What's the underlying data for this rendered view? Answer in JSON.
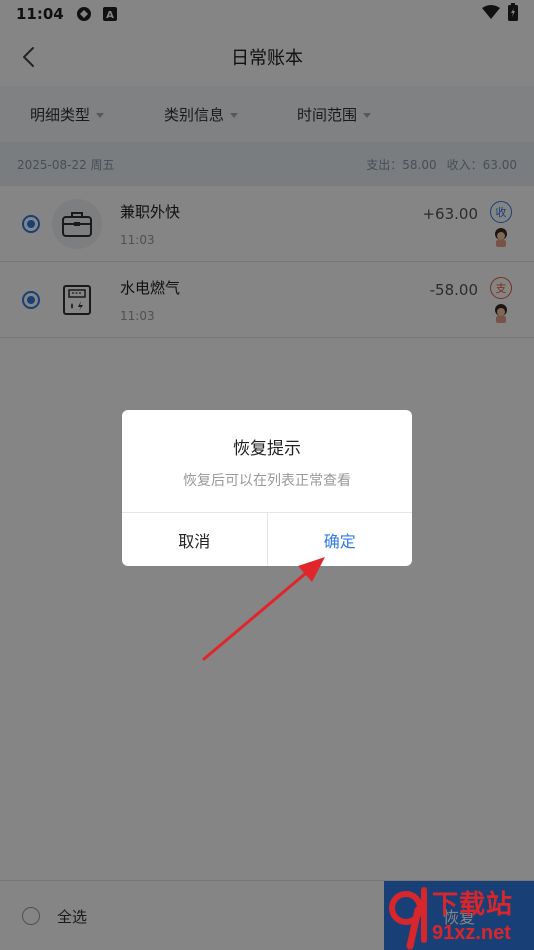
{
  "status": {
    "time": "11:04"
  },
  "header": {
    "title": "日常账本"
  },
  "filters": [
    {
      "label": "明细类型"
    },
    {
      "label": "类别信息"
    },
    {
      "label": "时间范围"
    }
  ],
  "day": {
    "date": "2025-08-22 周五",
    "expense": "支出：58.00",
    "income": "收入：63.00"
  },
  "records": [
    {
      "name": "兼职外快",
      "time": "11:03",
      "amount": "+63.00",
      "tag": "收",
      "category_icon": "briefcase-icon",
      "selected": true
    },
    {
      "name": "水电燃气",
      "time": "11:03",
      "amount": "-58.00",
      "tag": "支",
      "category_icon": "utility-meter-icon",
      "selected": true
    }
  ],
  "bottom": {
    "select_all": "全选",
    "restore": "恢复"
  },
  "dialog": {
    "title": "恢复提示",
    "message": "恢复后可以在列表正常查看",
    "cancel": "取消",
    "confirm": "确定"
  },
  "watermark": {
    "top_text": "下载站",
    "site": "91xz.net"
  },
  "colors": {
    "accent": "#2f7be5",
    "income_tag": "#2f7be5",
    "expense_tag": "#e55a3a",
    "arrow": "#e0262b"
  }
}
